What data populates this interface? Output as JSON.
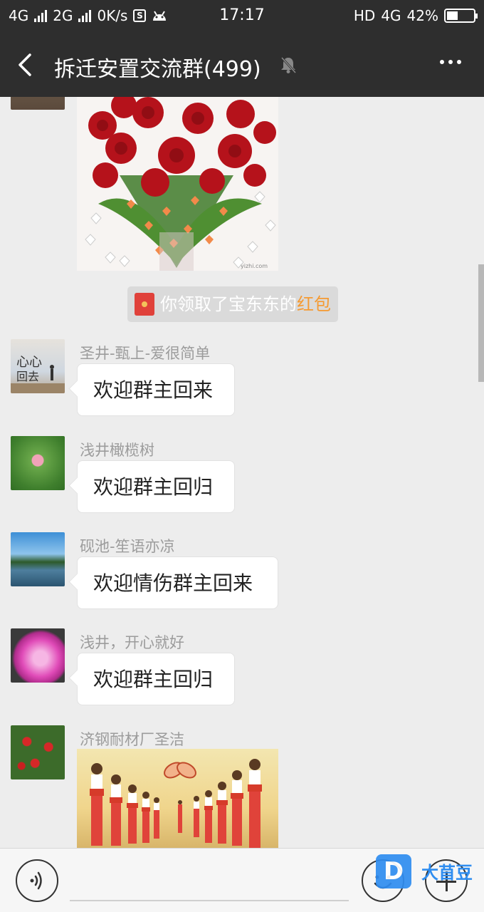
{
  "status_bar": {
    "net1": "4G",
    "net2": "2G",
    "speed": "0K/s",
    "s_badge": "S",
    "time": "17:17",
    "hd": "HD",
    "net3": "4G",
    "battery": "42%",
    "battery_level": 0.42
  },
  "header": {
    "title": "拆迁安置交流群(499)",
    "back_icon": "chevron-left-icon",
    "mute_icon": "bell-off-icon",
    "more_icon": "more-dots-icon"
  },
  "messages": [
    {
      "type": "image",
      "content": "roses bouquet with hearts",
      "watermark": "yizhi.com"
    },
    {
      "type": "system",
      "text": "你领取了宝东东的",
      "link": "红包"
    },
    {
      "sender": "圣井-甄上-爱很简单",
      "text": "欢迎群主回来"
    },
    {
      "sender": "浅井橄榄树",
      "text": "欢迎群主回归"
    },
    {
      "sender": "砚池-笙语亦凉",
      "text": "欢迎情伤群主回来"
    },
    {
      "sender": "浅井，开心就好",
      "text": "欢迎群主回归"
    },
    {
      "sender": "济钢耐材厂圣洁",
      "type": "image",
      "content": "welcome girls clapping"
    }
  ],
  "avatar_texts": {
    "a1": "心心",
    "a2": "回去"
  },
  "input_bar": {
    "voice_icon": "voice-icon",
    "emoji_icon": "emoji-icon",
    "plus_icon": "plus-icon",
    "watermark_logo": "D",
    "watermark_text": "大苜豆"
  },
  "colors": {
    "header_bg": "#2e2e2e",
    "chat_bg": "#ededed",
    "link": "#f59a32",
    "redpacket": "#e0413a"
  }
}
